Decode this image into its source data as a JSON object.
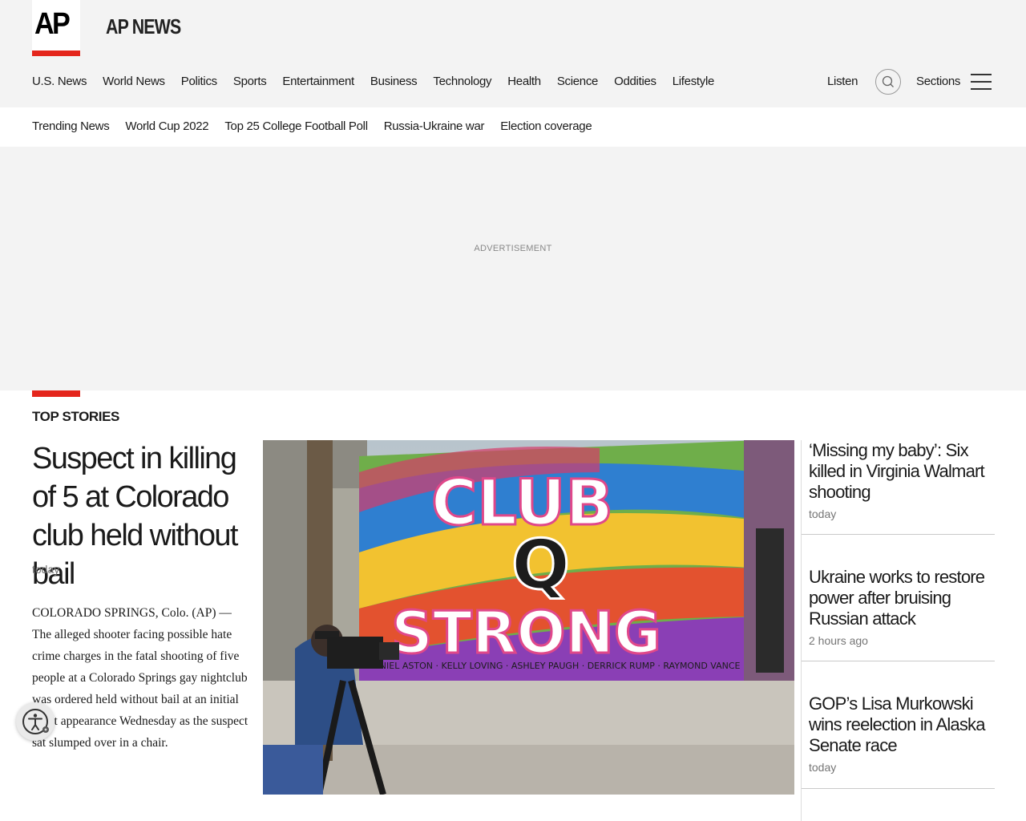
{
  "header": {
    "logo": "AP",
    "brand": "AP NEWS",
    "nav": [
      "U.S. News",
      "World News",
      "Politics",
      "Sports",
      "Entertainment",
      "Business",
      "Technology",
      "Health",
      "Science",
      "Oddities",
      "Lifestyle"
    ],
    "listen_label": "Listen",
    "sections_label": "Sections",
    "accent_color": "#e4261c"
  },
  "trending": [
    "Trending News",
    "World Cup 2022",
    "Top 25 College Football Poll",
    "Russia-Ukraine war",
    "Election coverage"
  ],
  "ad": {
    "label": "ADVERTISEMENT"
  },
  "top_stories": {
    "label": "TOP STORIES",
    "lead": {
      "headline": "Suspect in killing of 5 at Colorado club held without bail",
      "time": "today",
      "summary": "COLORADO SPRINGS, Colo. (AP) — The alleged shooter facing possible hate crime charges in the fatal shooting of five people at a Colorado Springs gay nightclub was ordered held without bail at an initial court appearance Wednesday as the suspect sat slumped over in a chair."
    },
    "image": {
      "mural_lines": [
        "CLUB",
        "Q",
        "STRONG"
      ],
      "mural_names": "DANIEL ASTON · KELLY LOVING · ASHLEY PAUGH · DERRICK RUMP · RAYMOND VANCE"
    },
    "side": [
      {
        "headline": "‘Missing my baby’: Six killed in Virginia Walmart shooting",
        "time": "today"
      },
      {
        "headline": "Ukraine works to restore power after bruising Russian attack",
        "time": "2 hours ago"
      },
      {
        "headline": "GOP’s Lisa Murkowski wins reelection in Alaska Senate race",
        "time": "today"
      }
    ]
  }
}
